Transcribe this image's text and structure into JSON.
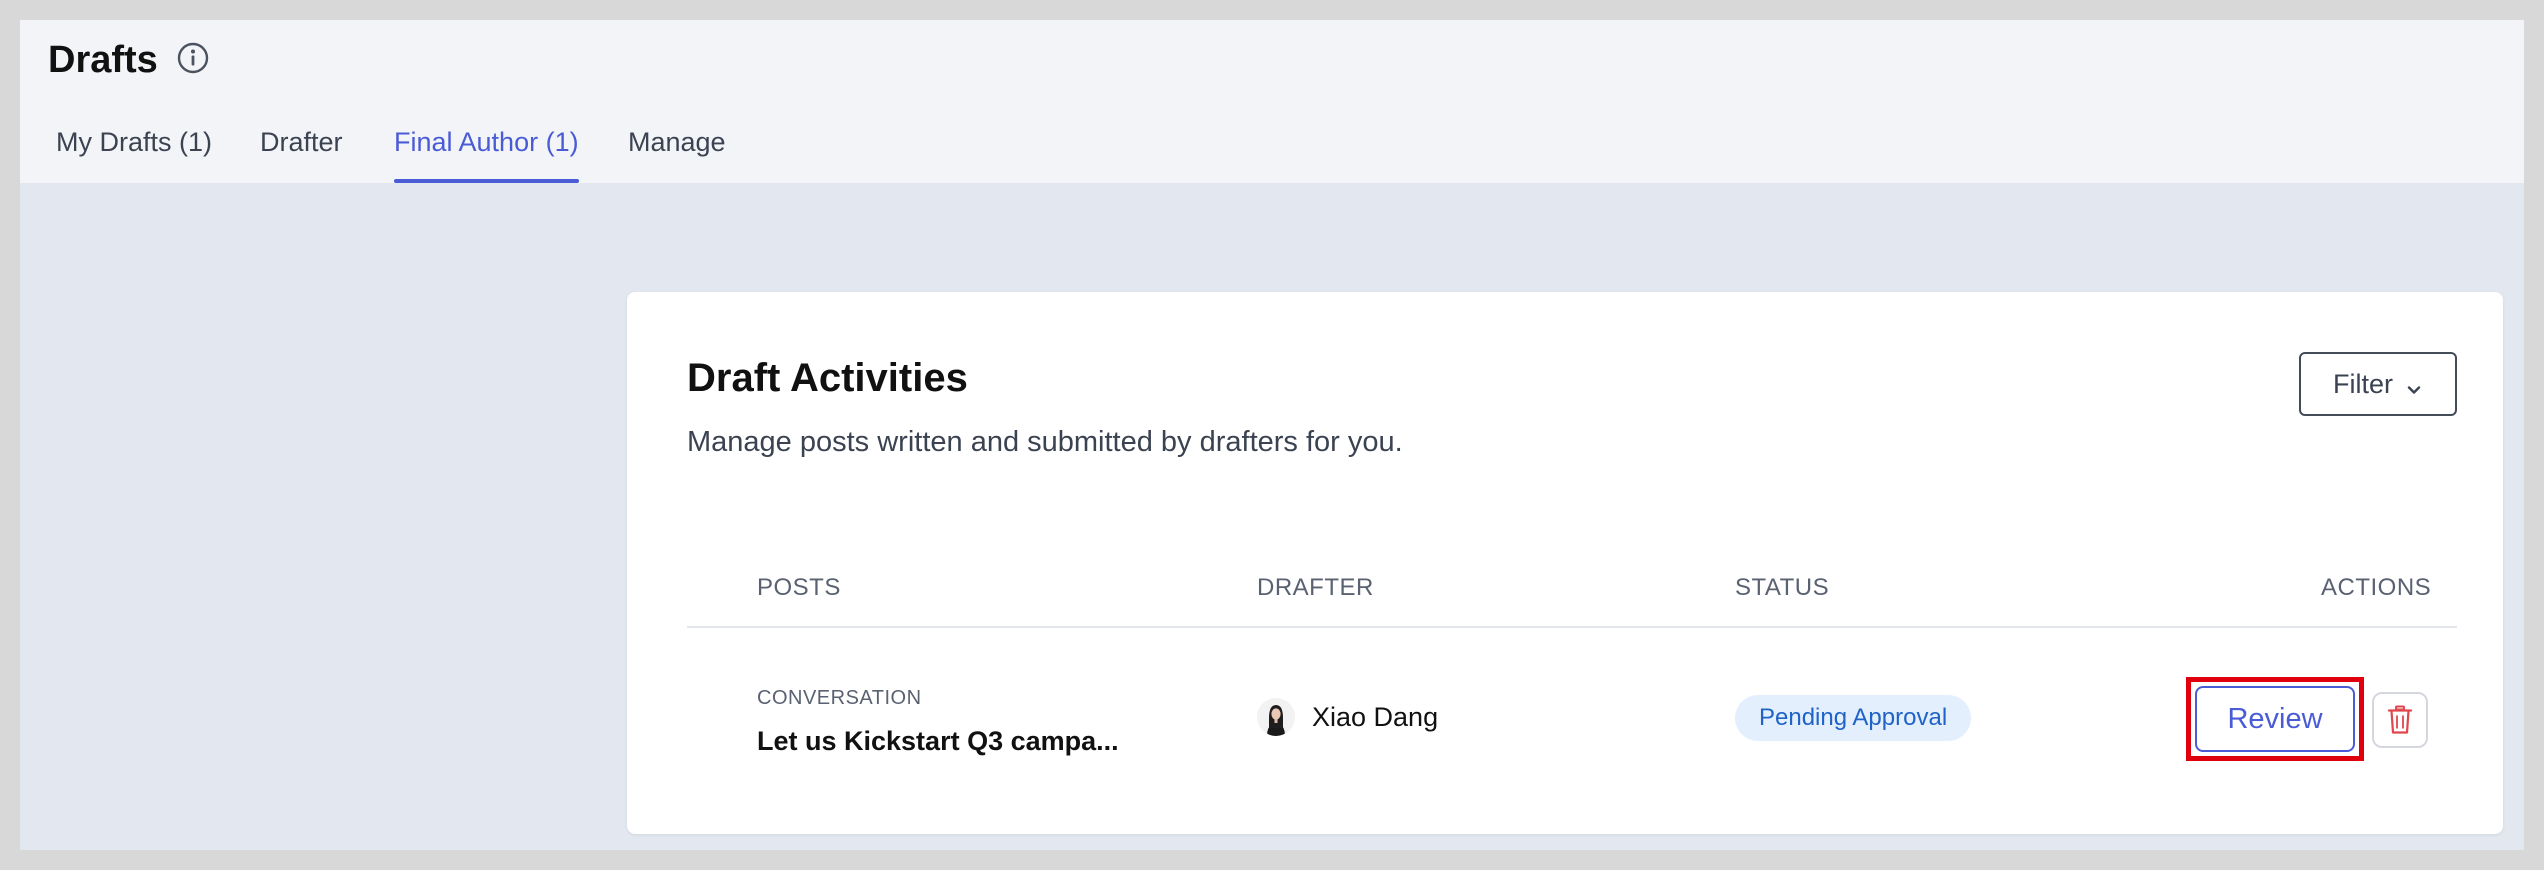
{
  "header": {
    "title": "Drafts"
  },
  "tabs": [
    {
      "label": "My Drafts (1)"
    },
    {
      "label": "Drafter"
    },
    {
      "label": "Final Author (1)"
    },
    {
      "label": "Manage"
    }
  ],
  "active_tab": "Final Author (1)",
  "card": {
    "title": "Draft Activities",
    "subtitle": "Manage posts written and submitted by drafters for you.",
    "filter_label": "Filter"
  },
  "table": {
    "columns": [
      "POSTS",
      "DRAFTER",
      "STATUS",
      "ACTIONS"
    ],
    "rows": [
      {
        "post_type": "CONVERSATION",
        "post_title": "Let us Kickstart Q3 campa...",
        "drafter": "Xiao Dang",
        "status": "Pending Approval",
        "action_label": "Review"
      }
    ]
  },
  "icons": {
    "info": "info-icon",
    "filter": "chevron-down-icon",
    "delete": "trash-icon"
  },
  "colors": {
    "accent": "#4a5bd6",
    "status_bg": "#e3effd",
    "status_text": "#1f63c7",
    "delete": "#e0474c",
    "highlight": "#e0000d"
  }
}
